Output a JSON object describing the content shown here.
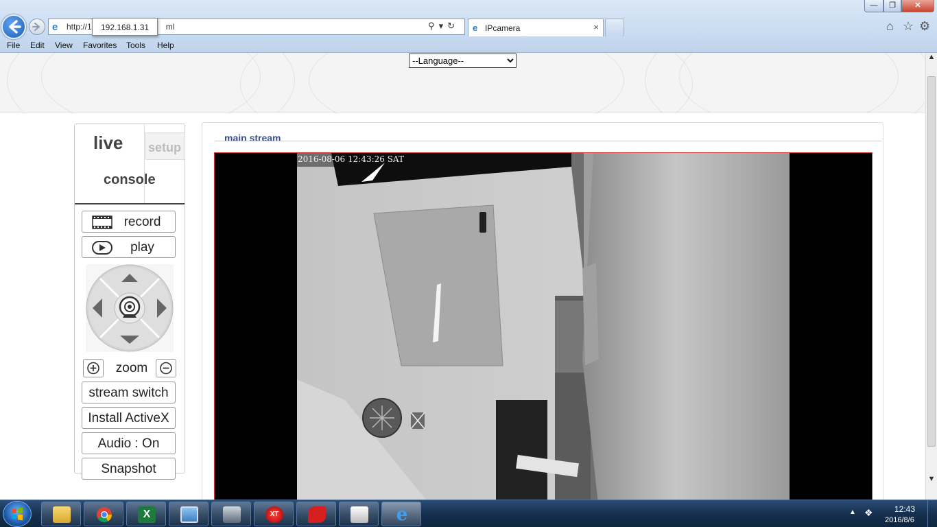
{
  "browser": {
    "address_url": "http://1",
    "address_url_tail": "ml",
    "url_tooltip": "192.168.1.31",
    "tab_title": "IPcamera",
    "tab_close": "×",
    "menu": [
      "File",
      "Edit",
      "View",
      "Favorites",
      "Tools",
      "Help"
    ]
  },
  "page": {
    "language_placeholder": "--Language--",
    "console": {
      "tab_live": "live",
      "tab_console": "console",
      "tab_setup": "setup",
      "record_label": "record",
      "play_label": "play",
      "zoom_label": "zoom",
      "stream_switch_label": "stream switch",
      "install_activex_label": "Install ActiveX",
      "audio_label": "Audio : On",
      "snapshot_label": "Snapshot"
    },
    "stream": {
      "title": "main stream",
      "osd_timestamp": "2016-08-06 12:43:26 SAT"
    }
  },
  "taskbar": {
    "time": "12:43",
    "date": "2016/8/6",
    "apps": [
      "explorer",
      "chrome",
      "excel",
      "image-viewer",
      "camera-app",
      "xt-app",
      "red-app",
      "ipcam-app",
      "internet-explorer"
    ]
  },
  "colors": {
    "stream_title": "#3a4f8a",
    "video_border": "#cc3333",
    "taskbar": "#16304f"
  }
}
